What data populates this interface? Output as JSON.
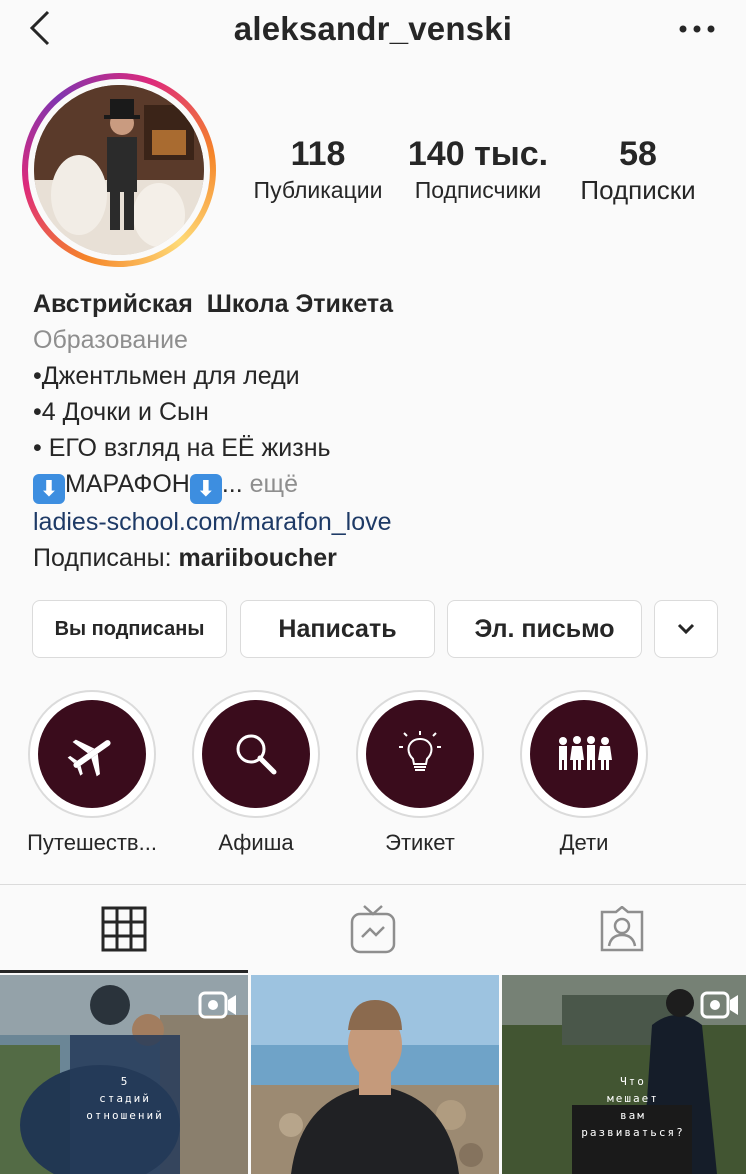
{
  "header": {
    "username": "aleksandr_venski",
    "back_icon": "chevron-left-icon",
    "more_icon": "more-horizontal-icon"
  },
  "stats": [
    {
      "value": "118",
      "label": "Публикации"
    },
    {
      "value": "140 тыс.",
      "label": "Подписчики"
    },
    {
      "value": "58",
      "label": "Подписки"
    }
  ],
  "bio": {
    "name": "Австрийская  Школа Этикета",
    "category": "Образование",
    "lines": [
      "•Джентльмен для леди",
      "•4 Дочки и Сын",
      "• ЕГО взгляд на ЕЁ жизнь"
    ],
    "marathon_text": "МАРАФОН",
    "ellipsis": "...",
    "more": "ещё",
    "link": "ladies-school.com/marafon_love",
    "followed_by_prefix": "Подписаны: ",
    "followed_by_user": "mariiboucher"
  },
  "actions": {
    "following": "Вы подписаны",
    "message": "Написать",
    "email": "Эл. письмо",
    "dropdown_icon": "chevron-down-icon"
  },
  "highlights": [
    {
      "label": "Путешеств...",
      "icon": "airplane-icon"
    },
    {
      "label": "Афиша",
      "icon": "magnifier-icon"
    },
    {
      "label": "Этикет",
      "icon": "lightbulb-icon"
    },
    {
      "label": "Дети",
      "icon": "children-icon"
    }
  ],
  "tabs": [
    {
      "icon": "grid-icon",
      "active": true
    },
    {
      "icon": "igtv-icon",
      "active": false
    },
    {
      "icon": "tagged-user-icon",
      "active": false
    }
  ],
  "posts": [
    {
      "overlay_text": [
        "5",
        "стадий",
        "отношений"
      ],
      "is_video": true
    },
    {
      "overlay_text": [],
      "is_video": false
    },
    {
      "overlay_text": [
        "Что",
        "мешает",
        "вам",
        "развиваться?"
      ],
      "is_video": true
    }
  ],
  "colors": {
    "highlight_bg": "#3a0c1c",
    "link": "#1e3a66",
    "muted": "#8e8e8e",
    "emoji_box": "#3d8ee0"
  }
}
